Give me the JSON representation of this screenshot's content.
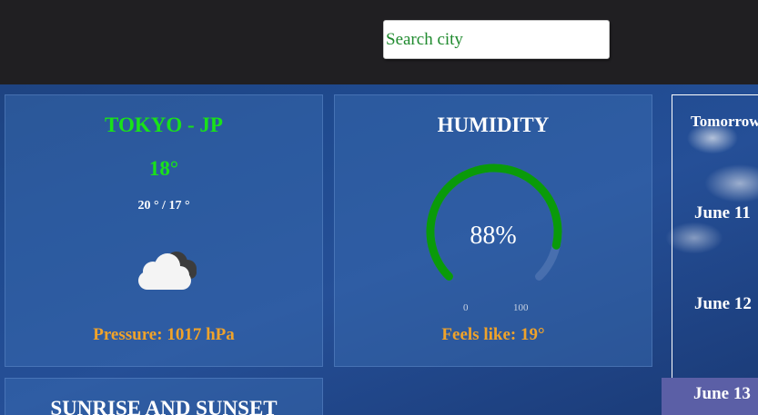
{
  "search": {
    "placeholder": "Search city"
  },
  "current": {
    "city": "TOKYO - JP",
    "temperature": "18°",
    "min_max": "20 ° / 17 °",
    "condition_icon": "cloudy-icon",
    "pressure": "Pressure: 1017 hPa"
  },
  "humidity": {
    "title": "HUMIDITY",
    "value_label": "88%",
    "value": 88,
    "min_label": "0",
    "max_label": "100",
    "feels_like": "Feels like: 19°"
  },
  "sun": {
    "title": "SUNRISE AND SUNSET"
  },
  "forecast": {
    "items": [
      "Tomorrow",
      "June 11",
      "June 12",
      "June 13"
    ],
    "selected_index": 3
  },
  "colors": {
    "accent_green": "#19e219",
    "accent_orange": "#f0a32a",
    "gauge_fill": "#0a9a0a",
    "selected_bg": "#5b5fa6"
  }
}
